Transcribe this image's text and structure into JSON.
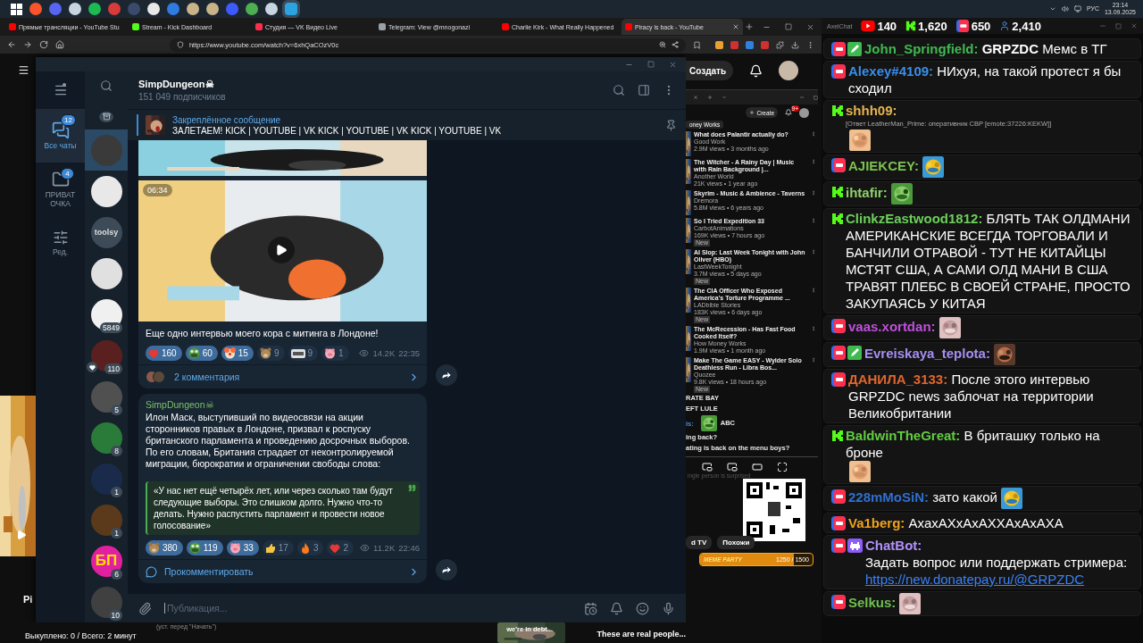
{
  "taskbar": {
    "apps": [
      {
        "color": "#ffffff",
        "kind": "windows",
        "selected": false
      },
      {
        "color": "#fb542b",
        "kind": "app",
        "selected": false
      },
      {
        "color": "#5865f2",
        "kind": "app",
        "selected": false
      },
      {
        "color": "#c7d5e0",
        "kind": "app",
        "selected": false
      },
      {
        "color": "#1db954",
        "kind": "app",
        "selected": false
      },
      {
        "color": "#d93b3b",
        "kind": "app",
        "selected": false
      },
      {
        "color": "#3b4a6b",
        "kind": "app",
        "selected": false
      },
      {
        "color": "#e8e8e8",
        "kind": "app",
        "selected": false
      },
      {
        "color": "#2f7be0",
        "kind": "app",
        "selected": false
      },
      {
        "color": "#c9b48a",
        "kind": "app",
        "selected": false
      },
      {
        "color": "#c9b48a",
        "kind": "app",
        "selected": false
      },
      {
        "color": "#3d5afe",
        "kind": "app",
        "selected": false
      },
      {
        "color": "#4caf50",
        "kind": "app",
        "selected": false
      },
      {
        "color": "#c7d5e0",
        "kind": "app",
        "selected": false
      },
      {
        "color": "#2aa3e0",
        "kind": "app",
        "selected": true
      }
    ]
  },
  "browser": {
    "tabs": [
      {
        "title": "Прямые трансляции - YouTube Stu",
        "kind": "youtube",
        "selected": false
      },
      {
        "title": "Stream - Kick Dashboard",
        "kind": "kick",
        "selected": false
      },
      {
        "title": "Студия — VK Видео Live",
        "kind": "vk",
        "selected": false
      },
      {
        "title": "Telegram: View @mnogonazi",
        "kind": "web",
        "selected": false
      },
      {
        "title": "Charlie Kirk - What Really Happened",
        "kind": "youtube",
        "selected": false
      },
      {
        "title": "Piracy is back - YouTube",
        "kind": "youtube",
        "selected": true
      }
    ],
    "url": "https://www.youtube.com/watch?v=6xhQaCOzV0c"
  },
  "stream": {
    "left_label": "Pi",
    "note": "(уст. перед \"Начать\")",
    "bought": "Выкуплено: 0 / Всего: 2 минут",
    "clip_caption": "we're in debt...",
    "clip_title": "These are real people..."
  },
  "telegram": {
    "folders": [
      {
        "label": "Все чаты",
        "badge": "12",
        "kind": "chats",
        "selected": true
      },
      {
        "label": "ПРИВАТ ОЧКА",
        "badge": "4",
        "kind": "folder",
        "selected": false
      },
      {
        "label": "Ред.",
        "kind": "edit",
        "selected": false
      }
    ],
    "chats": [
      {
        "selected": true,
        "reacted": false
      },
      {
        "selected": false,
        "reacted": false
      },
      {
        "selected": false,
        "reacted": false,
        "text": "toolsy"
      },
      {
        "selected": false,
        "reacted": false
      },
      {
        "selected": false,
        "reacted": false,
        "badge": "5849"
      },
      {
        "selected": false,
        "reacted": true,
        "badge": "110"
      },
      {
        "selected": false,
        "reacted": false,
        "badge": "5"
      },
      {
        "selected": false,
        "reacted": false,
        "badge": "8"
      },
      {
        "selected": false,
        "reacted": false,
        "badge": "1"
      },
      {
        "selected": false,
        "reacted": false,
        "badge": "1"
      },
      {
        "selected": false,
        "reacted": false,
        "badge": "6",
        "text": "БП"
      },
      {
        "selected": false,
        "reacted": false,
        "badge": "10"
      }
    ],
    "channel": {
      "title": "SimpDungeon☠",
      "subtitle": "151 049 подписчиков"
    },
    "pinned": {
      "title": "Закреплённое сообщение",
      "text": "ЗАЛЕТАЕМ!  KICK | YOUTUBE | VK KICK | YOUTUBE | VK KICK | YOUTUBE | VK"
    },
    "posts": [
      {
        "media": [
          {
            "kind": "picture"
          },
          {
            "kind": "video",
            "duration": "06:34"
          }
        ],
        "text": "Еще одно интервью моего кора с митинга в Лондоне!",
        "reactions": [
          {
            "kind": "heart",
            "count": "160",
            "selected": true
          },
          {
            "kind": "frog",
            "count": "60",
            "selected": true
          },
          {
            "kind": "clown",
            "count": "15",
            "selected": true
          },
          {
            "kind": "bear",
            "count": "9",
            "selected": false
          },
          {
            "kind": "tag",
            "count": "9",
            "selected": false
          },
          {
            "kind": "pig",
            "count": "1",
            "selected": false
          }
        ],
        "views": "14.2K",
        "time": "22:35",
        "comments": {
          "kind": "avatars",
          "label": "2 комментария"
        }
      },
      {
        "author": "SimpDungeon☠",
        "text": "Илон Маск, выступивший по видеосвязи на акции сторонников правых в Лондоне, призвал к роспуску британского парламента и проведению досрочных выборов. По его словам, Британия страдает от неконтролируемой миграции, бюрократии и ограничении свободы слова:",
        "quote": "«У нас нет ещё четырёх лет, или через сколько там будут следующие выборы. Это слишком долго. Нужно что-то делать. Нужно распустить парламент и провести новое голосование»",
        "reactions": [
          {
            "kind": "bear",
            "count": "380",
            "selected": true
          },
          {
            "kind": "frog",
            "count": "119",
            "selected": true
          },
          {
            "kind": "pig",
            "count": "33",
            "selected": true
          },
          {
            "kind": "thumb",
            "count": "17",
            "selected": false
          },
          {
            "kind": "fire",
            "count": "3",
            "selected": false
          },
          {
            "kind": "heart",
            "count": "2",
            "selected": false
          }
        ],
        "views": "11.2K",
        "time": "22:46",
        "comments": {
          "kind": "prompt",
          "label": "Прокомментировать"
        }
      }
    ],
    "composer": {
      "placeholder": "Публикация..."
    }
  },
  "youtube": {
    "create_button": "Создать",
    "inner": {
      "create_button": "Create",
      "notifications": "9+",
      "chip": "oney Works",
      "videos": [
        {
          "title": "What does Palantir actually do?",
          "channel": "Good Work",
          "meta": "2.9M views • 3 months ago"
        },
        {
          "title": "The Witcher - A Rainy Day | Music with Rain Background |...",
          "channel": "Another World",
          "meta": "21K views • 1 year ago"
        },
        {
          "title": "Skyrim - Music & Ambience - Taverns",
          "channel": "Dremora",
          "meta": "5.8M views • 6 years ago"
        },
        {
          "title": "So I Tried Expedition 33",
          "channel": "CarbotAnimations",
          "meta": "169K views • 7 hours ago",
          "tag": "New"
        },
        {
          "title": "AI Slop: Last Week Tonight with John Oliver (HBO)",
          "channel": "LastWeekTonight",
          "meta": "3.7M views • 5 days ago",
          "tag": "New"
        },
        {
          "title": "The CIA Officer Who Exposed America's Torture Programme ...",
          "channel": "LADbible Stories",
          "meta": "183K views • 6 days ago",
          "tag": "New"
        },
        {
          "title": "The McRecession - Has Fast Food Cooked Itself?",
          "channel": "How Money Works",
          "meta": "1.9M views • 1 month ago"
        },
        {
          "title": "Make The Game EASY - Wylder Solo Deathless Run - Libra Bos...",
          "channel": "Quozee",
          "meta": "9.8K views • 18 hours ago",
          "tag": "New"
        }
      ],
      "overlay": [
        {
          "kind": "line",
          "text": "RATE BAY"
        },
        {
          "kind": "line",
          "text": "EFT LULE"
        },
        {
          "kind": "emote",
          "name": "is:",
          "text": "ABC"
        },
        {
          "kind": "line",
          "text": "ing back?"
        },
        {
          "kind": "line",
          "text": "ating is back on the menu boys?"
        }
      ],
      "related_caption": "ingle person is surprised",
      "chips": [
        "d TV",
        "Похожи"
      ]
    },
    "meme_party": {
      "title": "MEME PARTY",
      "progress": "1250 / 1500",
      "level": 0.83
    }
  },
  "chat": {
    "tray": {
      "language": "РУС",
      "time": "23:14",
      "date": "13.09.2025"
    },
    "app_name": "AxelChat",
    "stats": [
      {
        "kind": "youtube",
        "count": "140"
      },
      {
        "kind": "kick",
        "count": "1,620"
      },
      {
        "kind": "vk",
        "count": "650"
      },
      {
        "kind": "viewers",
        "count": "2,410"
      }
    ],
    "messages": [
      {
        "kind": "vk",
        "badge": {
          "kind": "pencil"
        },
        "author": "John_Springfield:",
        "color": "#3fb950",
        "text": "**GRPZDC** Мемс в ТГ",
        "emote": false
      },
      {
        "kind": "vk",
        "author": "Alexey#4109:",
        "color": "#3b8eea",
        "text": "НИхуя, на такой протест я бы сходил",
        "emote": false
      },
      {
        "kind": "kick",
        "author": "shhh09:",
        "color": "#e6b450",
        "reply": "[Ответ LeatherMan_Prime: оперативник СВР [emote:37226:KEKW]]",
        "emote": true
      },
      {
        "kind": "vk",
        "author": "AJIEKCEY:",
        "color": "#7cc24f",
        "emote": true
      },
      {
        "kind": "kick",
        "author": "ihtafir:",
        "color": "#8fd16a",
        "emote": true
      },
      {
        "kind": "kick",
        "author": "ClinkzEastwood1812:",
        "color": "#6ccf5a",
        "text": "БЛЯТЬ ТАК ОЛДМАНИ АМЕРИКАНСКИЕ ВСЕГДА ТОРГОВАЛИ И БАНЧИЛИ ОТРАВОЙ - ТУТ НЕ КИТАЙЦЫ МСТЯТ США, А САМИ ОЛД МАНИ В США ТРАВЯТ ПЛЕБС В СВОЕЙ СТРАНЕ, ПРОСТО ЗАКУПАЯСЬ У КИТАЯ",
        "emote": false
      },
      {
        "kind": "vk",
        "author": "vaas.xortdan:",
        "color": "#c04fdc",
        "emote": true
      },
      {
        "kind": "vk",
        "badge": {
          "kind": "pencil"
        },
        "author": "Evreiskaya_teplota:",
        "color": "#a58ff0",
        "emote": true
      },
      {
        "kind": "vk",
        "author": "ДАНИЛА_3133:",
        "color": "#e0662e",
        "text": "После этого интервью GRPZDC news заблочат на территории Великобритании",
        "emote": false
      },
      {
        "kind": "kick",
        "author": "BaldwinTheGreat:",
        "color": "#62cc42",
        "text": "В бриташку только на броне",
        "emote": true
      },
      {
        "kind": "vk",
        "author": "228mMoSiN:",
        "color": "#2f6fcf",
        "text": "зато какой",
        "emote": true
      },
      {
        "kind": "vk",
        "author": "Va1berg:",
        "color": "#f0a21e",
        "text": "АхахАХхАхАХХАхАхАХА",
        "emote": false
      },
      {
        "kind": "vk",
        "badge": {
          "kind": "bot"
        },
        "author": "ChatBot:",
        "color": "#b291ff",
        "text": "Задать вопрос или поддержать стримера:",
        "link": "https://new.donatepay.ru/@GRPZDC",
        "emote": false
      },
      {
        "kind": "vk",
        "author": "Selkus:",
        "color": "#6fbf4f",
        "emote": true
      }
    ]
  }
}
